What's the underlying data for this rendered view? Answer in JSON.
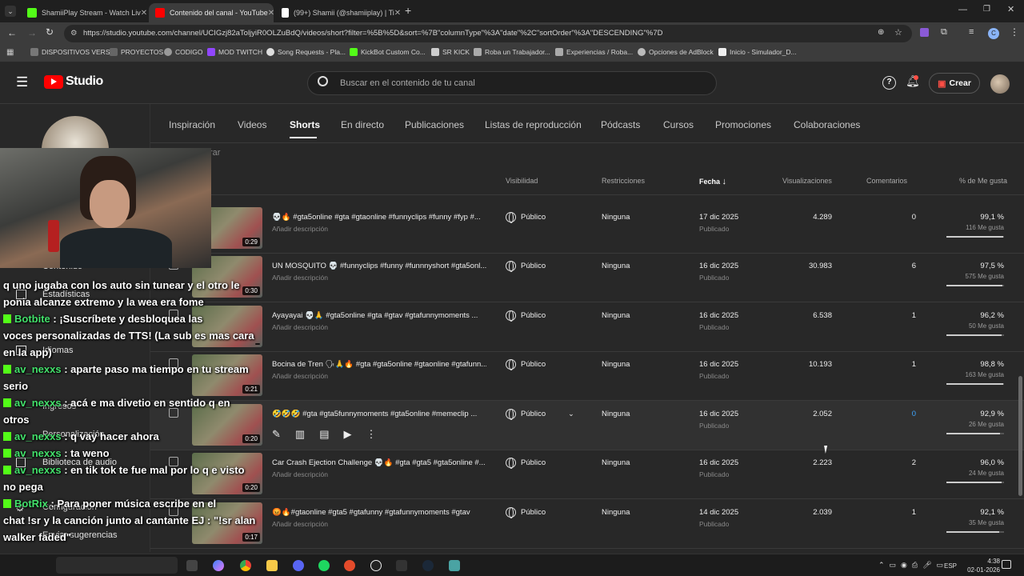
{
  "browser": {
    "tabs": [
      {
        "label": "ShamiiPlay Stream - Watch Liv",
        "favicon": "#53fc18"
      },
      {
        "label": "Contenido del canal - YouTube",
        "favicon": "#ff0000"
      },
      {
        "label": "(99+) Shamii (@shamiiplay) | Ti",
        "favicon": "#ffffff"
      }
    ],
    "url": "https://studio.youtube.com/channel/UCIGzj82aToljyiR0OLZuBdQ/videos/short?filter=%5B%5D&sort=%7B\"columnType\"%3A\"date\"%2C\"sortOrder\"%3A\"DESCENDING\"%7D",
    "bookmarks": [
      "DISPOSITIVOS VERSE",
      "PROYECTOS",
      "CODIGO",
      "MOD TWITCH",
      "Song Requests - Pla...",
      "KickBot Custom Co...",
      "SR KICK",
      "Roba un Trabajador...",
      "Experiencias / Roba...",
      "Opciones de AdBlock",
      "Inicio - Simulador_D..."
    ]
  },
  "studio": {
    "logo": "Studio",
    "search_placeholder": "Buscar en el contenido de tu canal",
    "create_label": "Crear"
  },
  "sidebar": {
    "items": [
      "Contenido",
      "Estadísticas",
      "Idiomas",
      "Ingresos",
      "Personalización",
      "Biblioteca de audio",
      "Configuración",
      "Enviar sugerencias"
    ],
    "filter_text": "rar"
  },
  "nav_tabs": [
    "Inspiración",
    "Videos",
    "Shorts",
    "En directo",
    "Publicaciones",
    "Listas de reproducción",
    "Pódcasts",
    "Cursos",
    "Promociones",
    "Colaboraciones"
  ],
  "table": {
    "headers": {
      "visibility": "Visibilidad",
      "restrictions": "Restricciones",
      "date": "Fecha",
      "views": "Visualizaciones",
      "comments": "Comentarios",
      "likes": "% de Me gusta"
    },
    "rows": [
      {
        "duration": "0:29",
        "title": "💀🔥 #gta5online #gta #gtaonline #funnyclips #funny #fyp #...",
        "desc": "Añadir descripción",
        "visibility": "Público",
        "restriction": "Ninguna",
        "date": "17 dic 2025",
        "status": "Publicado",
        "views": "4.289",
        "comments": "0",
        "pct": "99,1 %",
        "likes": "116 Me gusta",
        "ratio": 0.991
      },
      {
        "duration": "0:30",
        "title": "UN MOSQUITO 💀 #funnyclips #funny #funnnyshort #gta5onl...",
        "desc": "Añadir descripción",
        "visibility": "Público",
        "restriction": "Ninguna",
        "date": "16 dic 2025",
        "status": "Publicado",
        "views": "30.983",
        "comments": "6",
        "pct": "97,5 %",
        "likes": "575 Me gusta",
        "ratio": 0.975
      },
      {
        "duration": "",
        "title": "Ayayayai 💀🙏 #gta5online #gta #gtav #gtafunnymoments ...",
        "desc": "Añadir descripción",
        "visibility": "Público",
        "restriction": "Ninguna",
        "date": "16 dic 2025",
        "status": "Publicado",
        "views": "6.538",
        "comments": "1",
        "pct": "96,2 %",
        "likes": "50 Me gusta",
        "ratio": 0.962
      },
      {
        "duration": "0:21",
        "title": "Bocina de Tren 🗣🙏🔥 #gta #gta5online #gtaonline #gtafunn...",
        "desc": "Añadir descripción",
        "visibility": "Público",
        "restriction": "Ninguna",
        "date": "16 dic 2025",
        "status": "Publicado",
        "views": "10.193",
        "comments": "1",
        "pct": "98,8 %",
        "likes": "163 Me gusta",
        "ratio": 0.988
      },
      {
        "duration": "0:20",
        "title": "🤣🤣🤣 #gta #gta5funnymoments #gta5online #memeclip ...",
        "desc": "",
        "visibility": "Público",
        "restriction": "Ninguna",
        "date": "16 dic 2025",
        "status": "Publicado",
        "views": "2.052",
        "comments": "0",
        "pct": "92,9 %",
        "likes": "26 Me gusta",
        "ratio": 0.929,
        "hover": true
      },
      {
        "duration": "0:20",
        "title": "Car Crash Ejection Challenge 💀🔥 #gta #gta5 #gta5online #...",
        "desc": "Añadir descripción",
        "visibility": "Público",
        "restriction": "Ninguna",
        "date": "16 dic 2025",
        "status": "Publicado",
        "views": "2.223",
        "comments": "2",
        "pct": "96,0 %",
        "likes": "24 Me gusta",
        "ratio": 0.96
      },
      {
        "duration": "0:17",
        "title": "😡🔥#gtaonline #gta5 #gtafunny #gtafunnymoments #gtav",
        "desc": "Añadir descripción",
        "visibility": "Público",
        "restriction": "Ninguna",
        "date": "14 dic 2025",
        "status": "Publicado",
        "views": "2.039",
        "comments": "1",
        "pct": "92,1 %",
        "likes": "35 Me gusta",
        "ratio": 0.921
      }
    ]
  },
  "chat": [
    {
      "user": "",
      "text": "q uno jugaba con los auto sin tunear y el otro le"
    },
    {
      "user": "",
      "text": "ponia alcanze extremo y la wea era fome"
    },
    {
      "user": "Botbite",
      "text": ": ¡Suscríbete y desbloquea las"
    },
    {
      "user": "",
      "text": "voces personalizadas de TTS! (La sub es mas cara"
    },
    {
      "user": "",
      "text": "en la app)"
    },
    {
      "user": "av_nexxs",
      "text": ": aparte paso ma tiempo en tu stream"
    },
    {
      "user": "",
      "text": "serio"
    },
    {
      "user": "av_nexxs",
      "text": ": acá e ma divetio en sentido q en"
    },
    {
      "user": "",
      "text": "otros"
    },
    {
      "user": "av_nexxs",
      "text": ": q vay hacer ahora"
    },
    {
      "user": "av_nexxs",
      "text": ": ta weno"
    },
    {
      "user": "av_nexxs",
      "text": ": en tik tok te fue mal por lo q e visto"
    },
    {
      "user": "",
      "text": "no pega"
    },
    {
      "user": "BotRix",
      "text": ": Para poner música escribe en el"
    },
    {
      "user": "",
      "text": "chat !sr y la canción junto al cantante EJ : \"!sr alan"
    },
    {
      "user": "",
      "text": "walker faded\""
    }
  ],
  "taskbar": {
    "lang": "ESP",
    "time": "4:38",
    "date": "02-01-2026"
  }
}
